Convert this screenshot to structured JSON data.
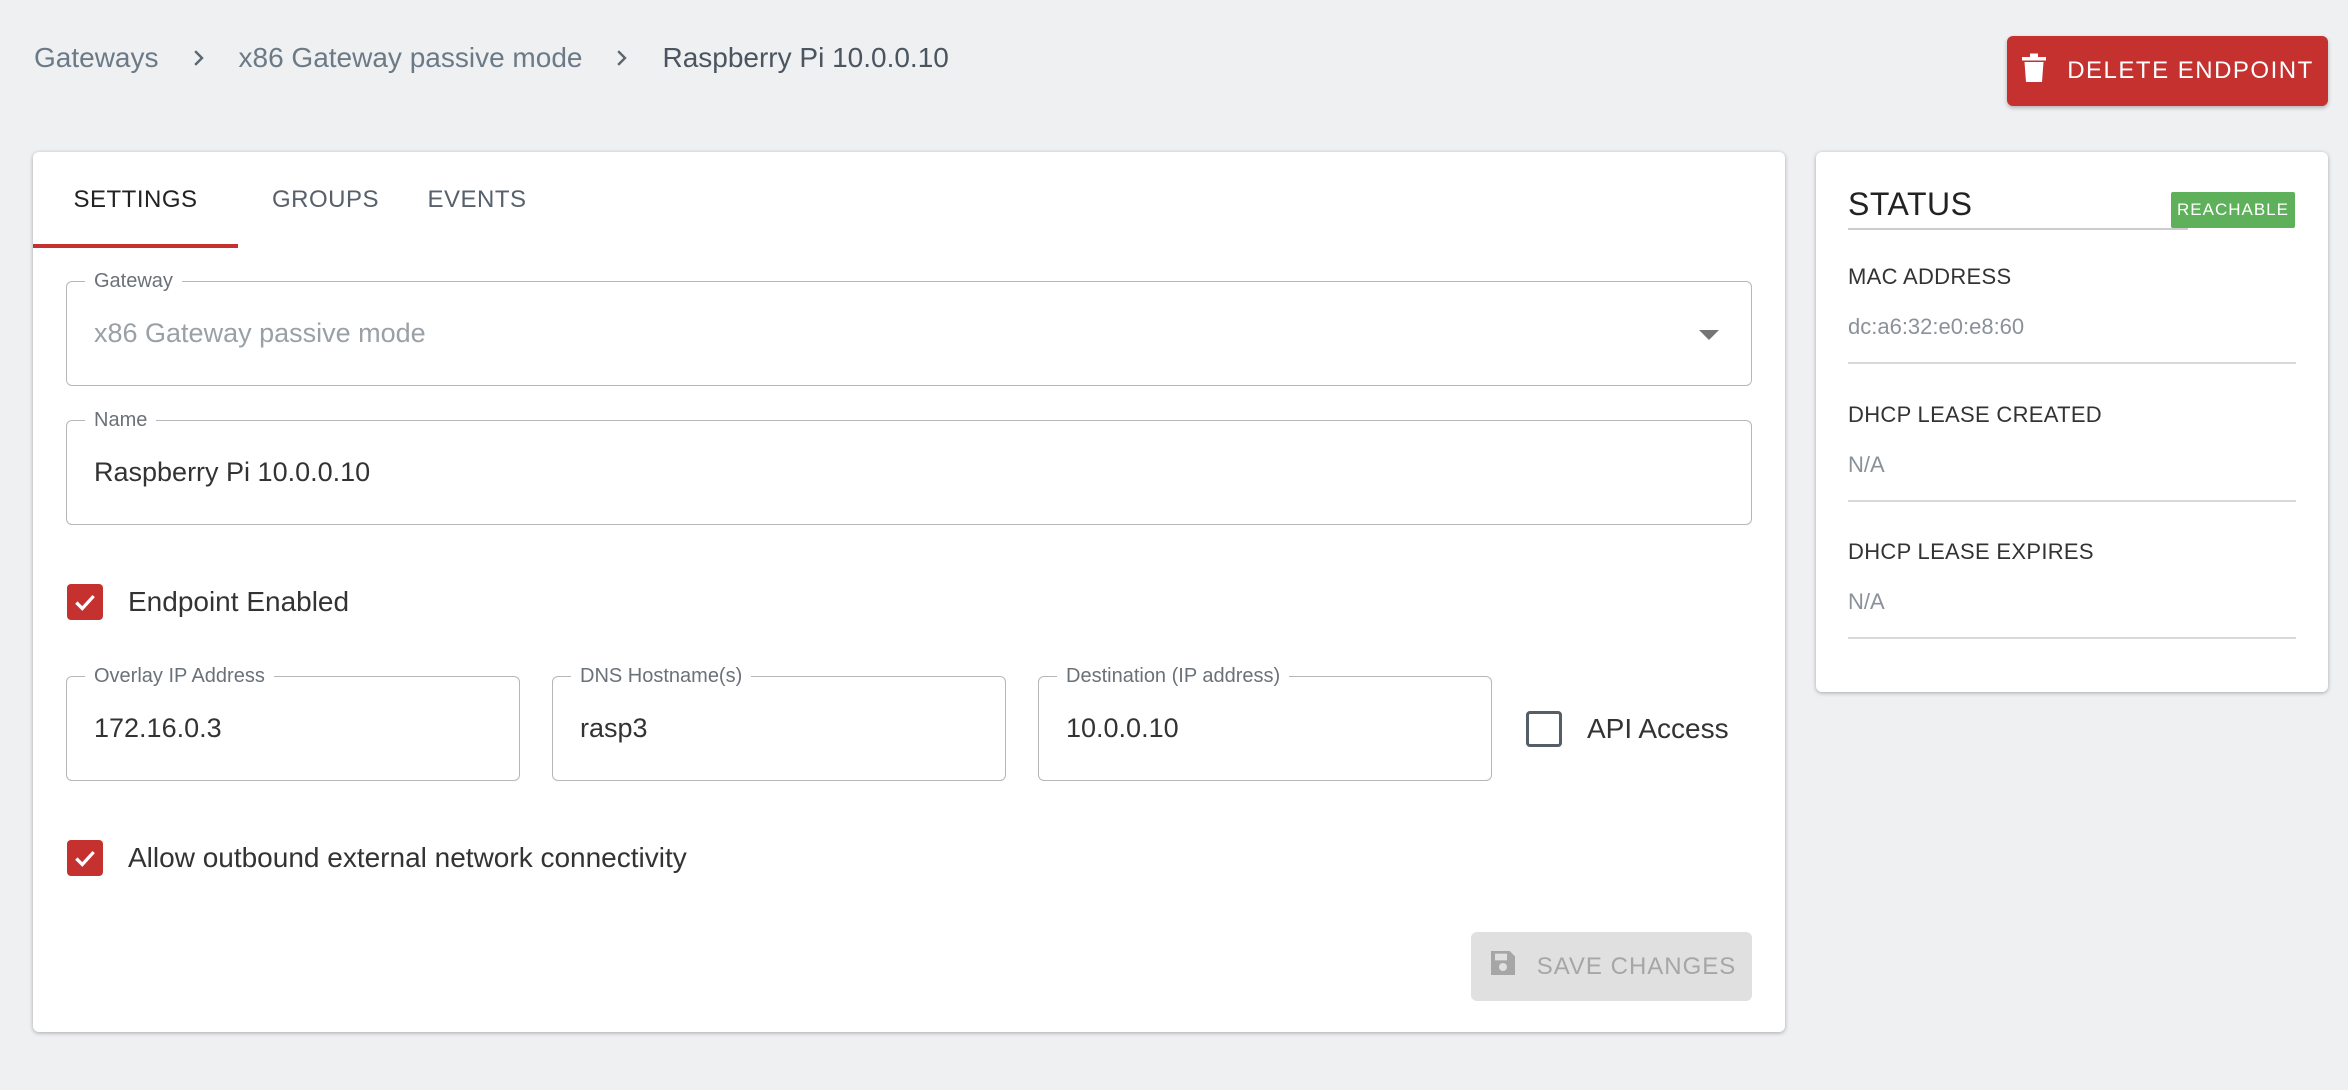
{
  "breadcrumb": {
    "items": [
      "Gateways",
      "x86 Gateway passive mode"
    ],
    "current": "Raspberry Pi 10.0.0.10"
  },
  "actions": {
    "delete_label": "DELETE ENDPOINT",
    "save_label": "SAVE CHANGES"
  },
  "tabs": [
    {
      "label": "SETTINGS",
      "active": true
    },
    {
      "label": "GROUPS",
      "active": false
    },
    {
      "label": "EVENTS",
      "active": false
    }
  ],
  "form": {
    "gateway": {
      "label": "Gateway",
      "value": "x86 Gateway passive mode"
    },
    "name": {
      "label": "Name",
      "value": "Raspberry Pi 10.0.0.10"
    },
    "endpoint_enabled": {
      "label": "Endpoint Enabled",
      "checked": true
    },
    "overlay_ip": {
      "label": "Overlay IP Address",
      "value": "172.16.0.3"
    },
    "dns_hostnames": {
      "label": "DNS Hostname(s)",
      "value": "rasp3"
    },
    "destination": {
      "label": "Destination (IP address)",
      "value": "10.0.0.10"
    },
    "api_access": {
      "label": "API Access",
      "checked": false
    },
    "outbound": {
      "label": "Allow outbound external network connectivity",
      "checked": true
    }
  },
  "status": {
    "title": "STATUS",
    "badge": "REACHABLE",
    "sections": [
      {
        "label": "MAC ADDRESS",
        "value": "dc:a6:32:e0:e8:60"
      },
      {
        "label": "DHCP LEASE CREATED",
        "value": "N/A"
      },
      {
        "label": "DHCP LEASE EXPIRES",
        "value": "N/A"
      }
    ]
  },
  "colors": {
    "accent": "#c4312f",
    "status_ok": "#5fb05a",
    "background": "#eff0f2"
  },
  "icons": {
    "breadcrumb_separator": "chevron-right-icon",
    "delete": "trash-icon",
    "save": "floppy-disk-icon",
    "dropdown": "caret-down-icon",
    "check": "check-icon"
  }
}
